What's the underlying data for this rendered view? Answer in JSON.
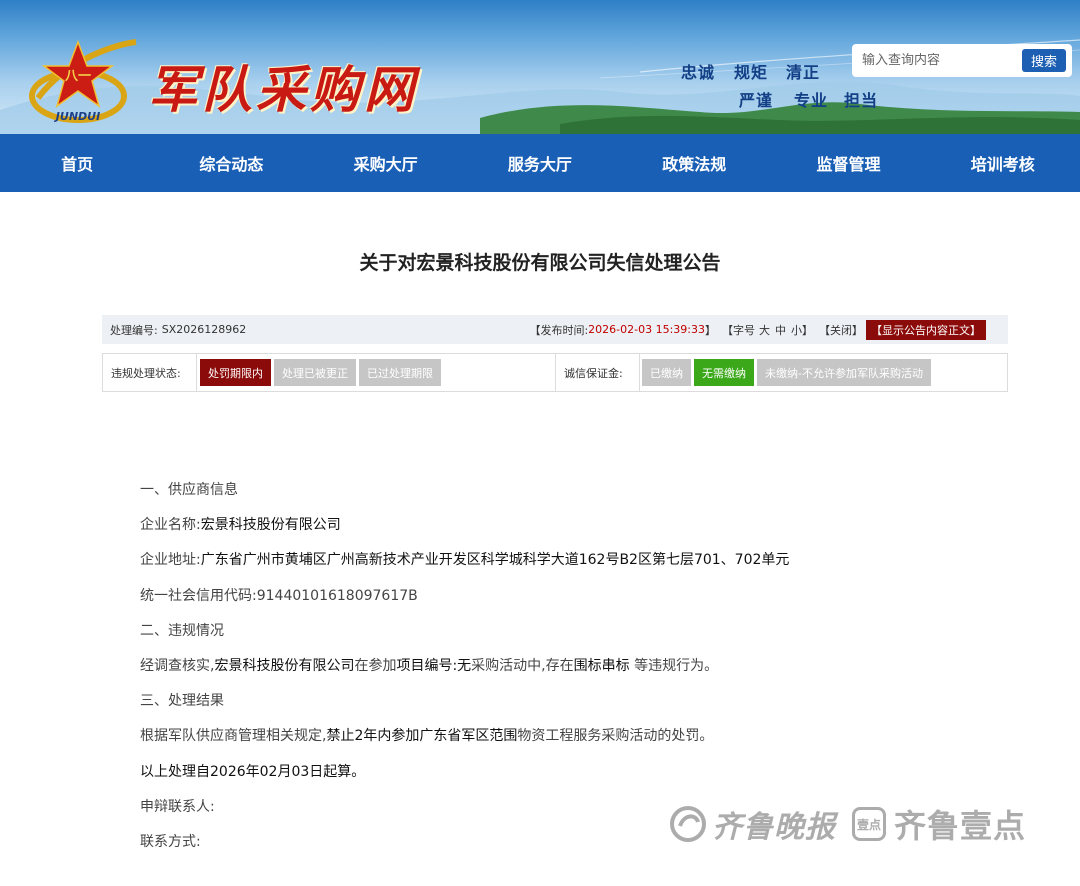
{
  "header": {
    "site_name": "军队采购网",
    "logo_text": "JUNDUI",
    "motto_line1": [
      "忠诚",
      "规矩",
      "清正"
    ],
    "motto_line2": [
      "严谨",
      "专业",
      "担当"
    ],
    "search_placeholder": "输入查询内容",
    "search_button": "搜索"
  },
  "nav": [
    "首页",
    "综合动态",
    "采购大厅",
    "服务大厅",
    "政策法规",
    "监督管理",
    "培训考核"
  ],
  "notice": {
    "title": "关于对宏景科技股份有限公司失信处理公告",
    "number_label": "处理编号:",
    "number": "SX2026128962",
    "time_label": "【发布时间:",
    "time": "2026-02-03 15:39:33",
    "time_close": "】",
    "font_label": "【字号",
    "font_large": "大",
    "font_medium": "中",
    "font_small": "小】",
    "close": "【关闭】",
    "show_body": "【显示公告内容正文】",
    "status_label": "违规处理状态:",
    "status_tags": [
      "处罚期限内",
      "处理已被更正",
      "已过处理期限"
    ],
    "deposit_label": "诚信保证金:",
    "deposit_tags": [
      "已缴纳",
      "无需缴纳",
      "未缴纳-不允许参加军队采购活动"
    ]
  },
  "content": {
    "s1": "一、供应商信息",
    "name_label": "企业名称:",
    "name": "宏景科技股份有限公司",
    "addr_label": "企业地址:",
    "addr": "广东省广州市黄埔区广州高新技术产业开发区科学城科学大道162号B2区第七层701、702单元",
    "code_label": "统一社会信用代码:",
    "code": "91440101618097617B",
    "s2": "二、违规情况",
    "v_a": "经调查核实,",
    "v_b": "宏景科技股份有限公司",
    "v_c": "在参加",
    "v_d": "项目编号:无",
    "v_e": "采购活动中,存在",
    "v_f": "围标串标",
    "v_g": " 等违规行为。",
    "s3": "三、处理结果",
    "r_a": "根据军队供应商管理相关规定,",
    "r_b": "禁止2年内参加广东省军区范围",
    "r_c": "物资工程服务采购活动的处罚。",
    "start": "以上处理自2026年02月03日起算。",
    "appeal": "申辩联系人:",
    "contact": "联系方式:"
  },
  "watermark": {
    "brand1": "齐鲁晚报",
    "box": "壹点",
    "brand2": "齐鲁壹点"
  },
  "colors": {
    "nav_bg": "#1a5fb6",
    "accent_red": "#8b0a0a",
    "tag_green": "#3aa818",
    "tag_grey": "#c6c6c6"
  }
}
